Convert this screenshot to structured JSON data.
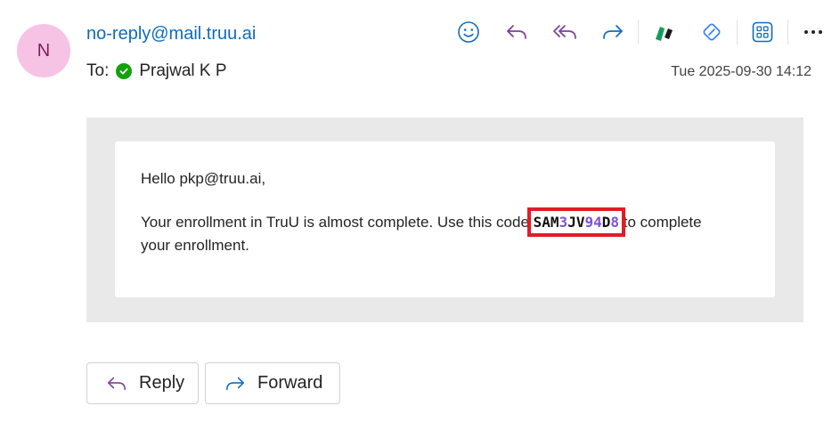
{
  "avatar": {
    "initial": "N",
    "bg": "#f6c3e5"
  },
  "sender": {
    "email": "no-reply@mail.truu.ai"
  },
  "recipient": {
    "to_label": "To:",
    "name": "Prajwal K P"
  },
  "date": "Tue 2025-09-30 14:12",
  "toolbar": {
    "icons": [
      "emoji-icon",
      "reply-icon",
      "reply-all-icon",
      "forward-icon",
      "app-icon",
      "loop-icon",
      "apps-grid-icon",
      "more-icon"
    ]
  },
  "message": {
    "greeting": "Hello pkp@truu.ai,",
    "line_before": "Your enrollment in TruU is almost complete. Use this code",
    "code_parts": [
      "SAM",
      "3",
      "JV",
      "94",
      "D",
      "8"
    ],
    "line_after": "to complete your enrollment."
  },
  "actions": {
    "reply_label": "Reply",
    "forward_label": "Forward"
  },
  "colors": {
    "accent": "#0f6cbd",
    "reply_icon": "#7f3f98",
    "highlight": "#e31b23",
    "code_digit": "#7f52d8"
  }
}
